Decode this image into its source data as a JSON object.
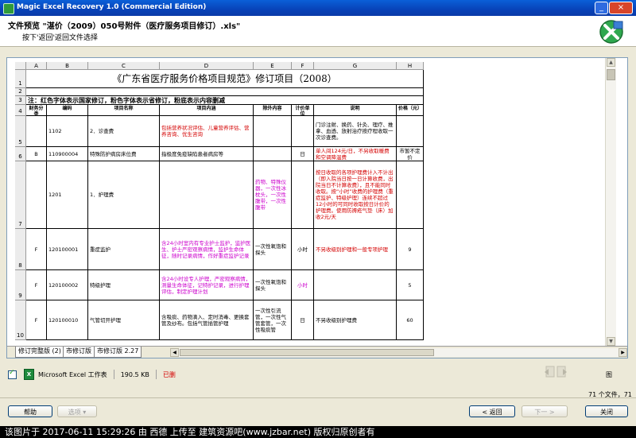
{
  "window": {
    "title": "Magic Excel Recovery 1.0 (Commercial Edition)"
  },
  "header": {
    "title": "文件预览 \"湛价（2009）050号附件（医疗服务项目修订）.xls\"",
    "subtitle": "按下'返回'返回文件选择"
  },
  "spreadsheet": {
    "columns": [
      "A",
      "B",
      "C",
      "D",
      "E",
      "F",
      "G",
      "H"
    ],
    "title_row": "《广东省医疗服务价格项目规范》修订项目（2008）",
    "note_row": "注：红色字体表示国家修订，粉色字体表示省修订，粉底表示内容删减",
    "header": [
      "财务分类",
      "编码",
      "项目名称",
      "项目内涵",
      "除外内容",
      "计价单位",
      "说明",
      "价格（元）"
    ],
    "rows": [
      {
        "num": "5",
        "a": "",
        "b": "1102",
        "c": "2．诊查费",
        "d": "包括营养状况评估、儿童营养评估、营养咨询、优生咨询",
        "e": "",
        "f": "",
        "g": "门诊注射、换药、针灸、理疗、推拿、血透、放射治疗按疗程收取一次诊查费。",
        "h": ""
      },
      {
        "num": "6",
        "a": "B",
        "b": "110900004",
        "c": "特殊防护病房床位费",
        "d": "指极度免疫缺陷患者病房等",
        "e": "",
        "f": "日",
        "g": "单人间124元/日，不另收取暖费和空调降温费",
        "h": "市暂不定价"
      },
      {
        "num": "7",
        "a": "",
        "b": "1201",
        "c": "1．护理费",
        "d": "",
        "e": "药物、特殊仪器，一次性冰枕头，一次性腹带，一次性腹带",
        "f": "",
        "g": "按日收取的各项护理费计入不计出（即入院当日按一日计算收费，出院当日不计算收费），且不能同时收取。按“小时”收费的护理费（重症监护、特级护理）连续不超过12小时的可同时收取按日计价的护理费。使用防褥疮气垫（床）加收2元/天",
        "h": ""
      },
      {
        "num": "8",
        "a": "F",
        "b": "120100001",
        "c": "重症监护",
        "d": "含24小时室内有专业护士监护，监护医生、护士严密观察病情，监护生命体征，随时记录病情，作好重症监护记录",
        "e": "一次性氧饱和探头",
        "f": "小时",
        "g": "不另收级别护理和一般专项护理",
        "h": "9"
      },
      {
        "num": "9",
        "a": "F",
        "b": "120100002",
        "c": "特级护理",
        "d": "含24小时设专人护理，严密观察病情，测量生命体征，记特护记录，进行护理评估，制定护理计划",
        "e": "一次性氧饱和探头",
        "f": "小时",
        "g": "",
        "h": "5"
      },
      {
        "num": "10",
        "a": "F",
        "b": "120100010",
        "c": "气管切开护理",
        "d": "含吸痰、药物滴入、定时消毒、更换套管及纱布。包括气管插管护理",
        "e": "一次性引流管，一次性气管套管，一次性吸痰管",
        "f": "日",
        "g": "不另收级别护理费",
        "h": "60"
      }
    ],
    "tabs": [
      "修订完整版 (2)",
      "市修订版 (1)",
      "市修订版 2.27"
    ]
  },
  "status": {
    "file_type": "Microsoft Excel 工作表",
    "file_size": "190.5 KB",
    "file_state": "已删"
  },
  "side_label": "图",
  "count_text": "71 个文件，71",
  "buttons": {
    "help": "帮助",
    "options": "选项 ▾",
    "back": "< 返回",
    "next": "下一 >",
    "close": "关闭"
  },
  "footer": "该图片于 2017-06-11 15:29:26 由 西德 上传至 建筑资源吧(www.jzbar.net) 版权归原创者有"
}
